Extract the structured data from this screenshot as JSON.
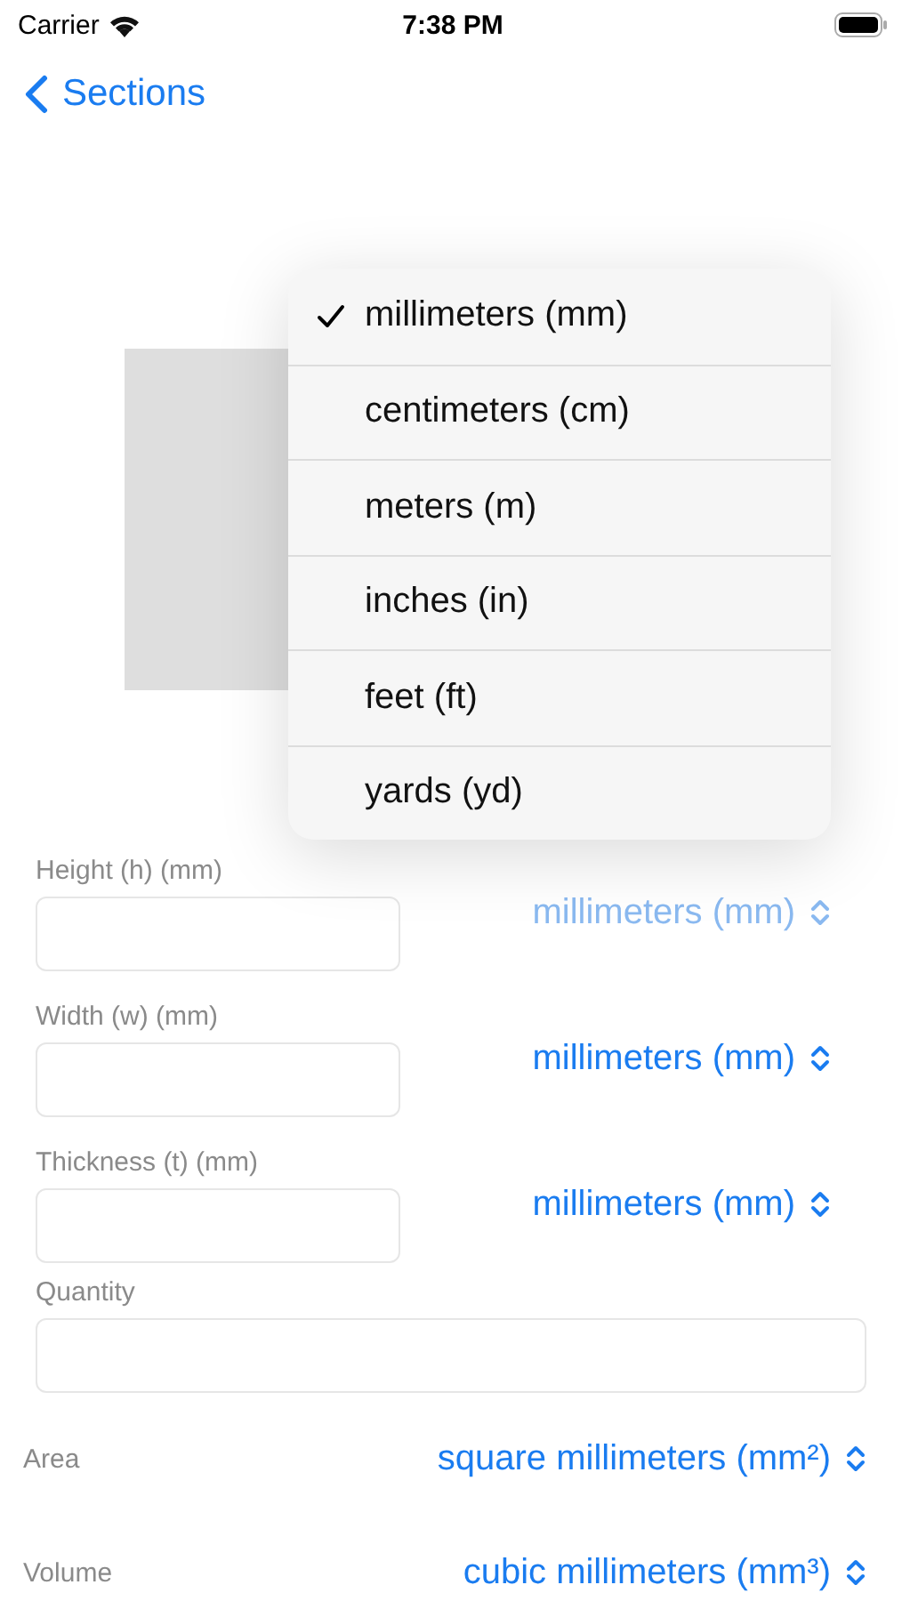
{
  "status_bar": {
    "carrier": "Carrier",
    "time": "7:38 PM"
  },
  "nav": {
    "back_label": "Sections"
  },
  "shape": {
    "kind": "rectangle"
  },
  "fields": [
    {
      "label": "Height (h) (mm)",
      "unit": "millimeters (mm)",
      "open": true
    },
    {
      "label": "Width (w) (mm)",
      "unit": "millimeters (mm)",
      "open": false
    },
    {
      "label": "Thickness (t) (mm)",
      "unit": "millimeters (mm)",
      "open": false
    }
  ],
  "quantity": {
    "label": "Quantity"
  },
  "results": [
    {
      "label": "Area",
      "unit": "square millimeters (mm²)"
    },
    {
      "label": "Volume",
      "unit": "cubic millimeters (mm³)"
    }
  ],
  "unit_menu": [
    {
      "label": "millimeters (mm)",
      "selected": true
    },
    {
      "label": "centimeters (cm)",
      "selected": false
    },
    {
      "label": "meters (m)",
      "selected": false
    },
    {
      "label": "inches (in)",
      "selected": false
    },
    {
      "label": "feet (ft)",
      "selected": false
    },
    {
      "label": "yards (yd)",
      "selected": false
    }
  ]
}
